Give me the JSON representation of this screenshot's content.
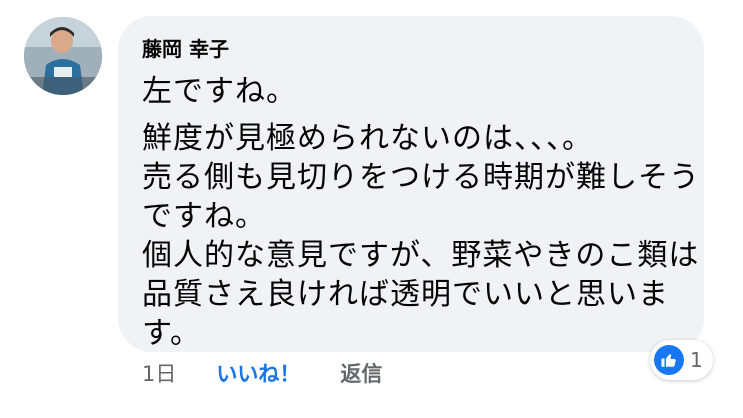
{
  "comment": {
    "author": "藤岡 幸子",
    "lines": [
      "左ですね。",
      "鮮度が見極められないのは、、、。",
      "売る側も見切りをつける時期が難しそう",
      "ですね。",
      "個人的な意見ですが、野菜やきのこ類は",
      "品質さえ良ければ透明でいいと思いま",
      "す。"
    ]
  },
  "actions": {
    "time": "1日",
    "like_label": "いいね！",
    "reply_label": "返信"
  },
  "reactions": {
    "icon": "thumbs-up-icon",
    "count": "1",
    "color": "#1877f2"
  },
  "colors": {
    "bubble": "#f0f2f5",
    "text": "#050505",
    "meta": "#65676b",
    "accent": "#1b74e4"
  }
}
